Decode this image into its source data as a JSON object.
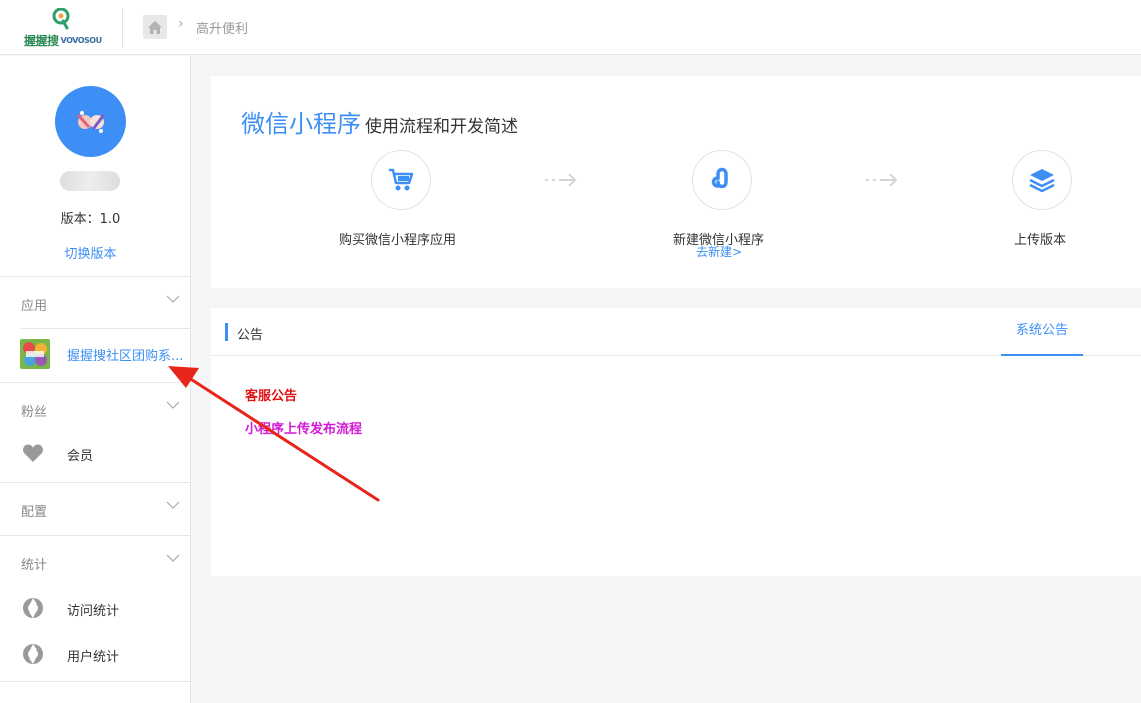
{
  "header": {
    "logo_text": "握握搜",
    "logo_sub": "VOVOSOU",
    "breadcrumb": "高升便利"
  },
  "sidebar": {
    "version_label": "版本：1.0",
    "switch_version": "切换版本",
    "sections": [
      {
        "title": "应用",
        "items": [
          {
            "label": "握握搜社区团购系..."
          }
        ]
      },
      {
        "title": "粉丝",
        "items": [
          {
            "label": "会员"
          }
        ]
      },
      {
        "title": "配置",
        "items": []
      },
      {
        "title": "统计",
        "items": [
          {
            "label": "访问统计"
          },
          {
            "label": "用户统计"
          }
        ]
      }
    ]
  },
  "flow": {
    "title_main": "微信小程序",
    "title_sub": "使用流程和开发简述",
    "steps": [
      {
        "label": "购买微信小程序应用",
        "icon": "cart-icon"
      },
      {
        "label": "新建微信小程序",
        "link": "去新建>",
        "icon": "mini-program-icon"
      },
      {
        "label": "上传版本",
        "icon": "layers-icon"
      }
    ]
  },
  "notice": {
    "title": "公告",
    "tab": "系统公告",
    "lines": [
      {
        "text": "客服公告",
        "color": "#e01414"
      },
      {
        "text": "小程序上传发布流程",
        "color": "#d21ad6"
      }
    ]
  },
  "colors": {
    "accent": "#3d8ff5",
    "annotation_arrow": "#e8251a"
  }
}
